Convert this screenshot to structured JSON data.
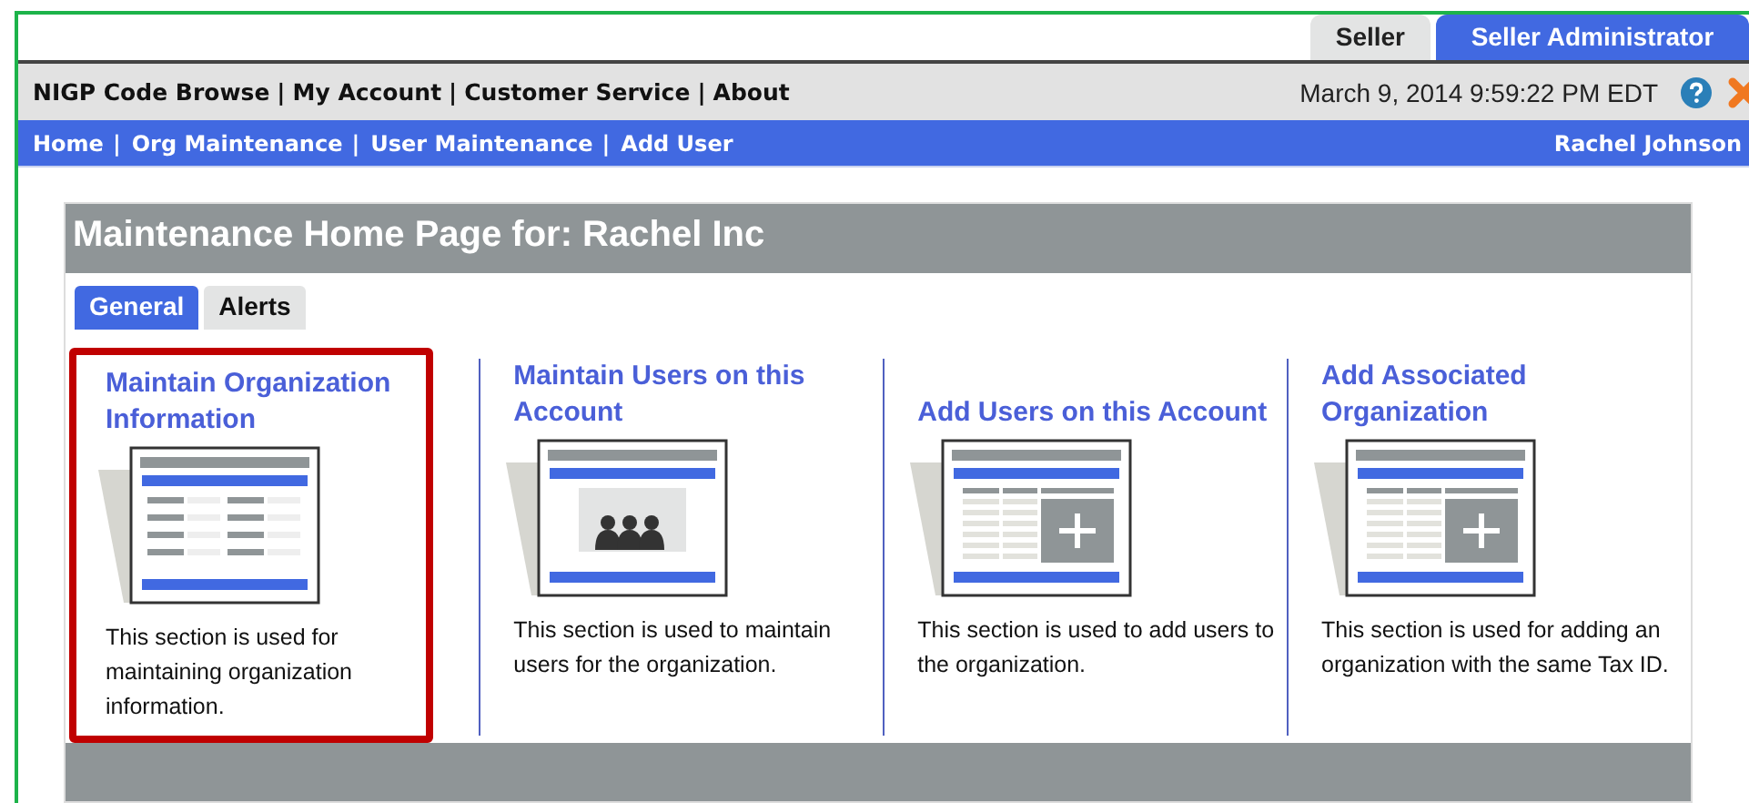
{
  "role_tabs": [
    {
      "label": "Seller",
      "selected": false
    },
    {
      "label": "Seller Administrator",
      "selected": true
    }
  ],
  "top_links": [
    {
      "kind": "link",
      "text": "NIGP Code Browse"
    },
    {
      "kind": "separator",
      "text": "|"
    },
    {
      "kind": "link",
      "text": "My Account"
    },
    {
      "kind": "separator",
      "text": "|"
    },
    {
      "kind": "link",
      "text": "Customer Service"
    },
    {
      "kind": "separator",
      "text": "|"
    },
    {
      "kind": "link",
      "text": "About"
    }
  ],
  "datetime": "March 9, 2014 9:59:22 PM EDT",
  "breadcrumbs": [
    {
      "kind": "link",
      "text": "Home"
    },
    {
      "kind": "separator",
      "text": "|"
    },
    {
      "kind": "link",
      "text": "Org Maintenance"
    },
    {
      "kind": "separator",
      "text": "|"
    },
    {
      "kind": "link",
      "text": "User Maintenance"
    },
    {
      "kind": "separator",
      "text": "|"
    },
    {
      "kind": "link",
      "text": "Add User"
    }
  ],
  "user_name": "Rachel Johnson",
  "panel": {
    "title": "Maintenance Home Page for: Rachel Inc",
    "tabs": [
      {
        "label": "General",
        "selected": true
      },
      {
        "label": "Alerts",
        "selected": false
      }
    ],
    "cards": [
      {
        "title": "Maintain Organization Information",
        "kind": "list",
        "highlighted": true,
        "description": "This section is used for maintaining organization information."
      },
      {
        "title": "Maintain Users on this Account",
        "kind": "people",
        "highlighted": false,
        "description": "This section is used to maintain users for the organization."
      },
      {
        "title": "Add Users on this Account",
        "kind": "add",
        "highlighted": false,
        "description": "This section is used to add users to the organization."
      },
      {
        "title": "Add Associated Organization",
        "kind": "add",
        "highlighted": false,
        "description": "This section is used for adding an organization with the same Tax ID."
      }
    ]
  }
}
